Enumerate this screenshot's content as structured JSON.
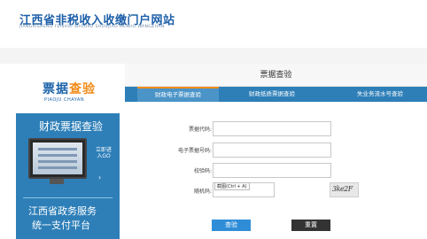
{
  "header": {
    "title": "江西省非税收入收缴门户网站",
    "subtitle": "JIANGXISHENG FEISHUI SHOURU SHOUJIAO MENHU WANGZHAN"
  },
  "sidebar": {
    "brand_part1": "票据",
    "brand_part2": "查验",
    "brand_pinyin": "PIAOJU CHAYAN",
    "section_title": "财政票据查验",
    "enter_label": "立即进入GO",
    "enter_arrow": "›",
    "bottom_line1": "江西省政务服务",
    "bottom_line2": "统一支付平台"
  },
  "main": {
    "panel_title": "票据查验",
    "tabs": [
      {
        "label": "财政电子票据查验",
        "active": true
      },
      {
        "label": "财政纸质票据查验",
        "active": false
      },
      {
        "label": "失业务流水号查验",
        "active": false
      }
    ],
    "fields": [
      {
        "label": "票据代码:",
        "value": ""
      },
      {
        "label": "电子票据号码:",
        "value": ""
      },
      {
        "label": "校验码:",
        "value": ""
      },
      {
        "label": "随机码:",
        "value": ""
      }
    ],
    "tooltip": "截图(Ctrl + A)",
    "captcha_text": "3ke2F",
    "query_button": "查验",
    "reset_button": "重置"
  },
  "colors": {
    "primary": "#2e7fb8",
    "accent": "#f08c1a",
    "button_blue": "#2f8dd8",
    "button_dark": "#333333"
  }
}
